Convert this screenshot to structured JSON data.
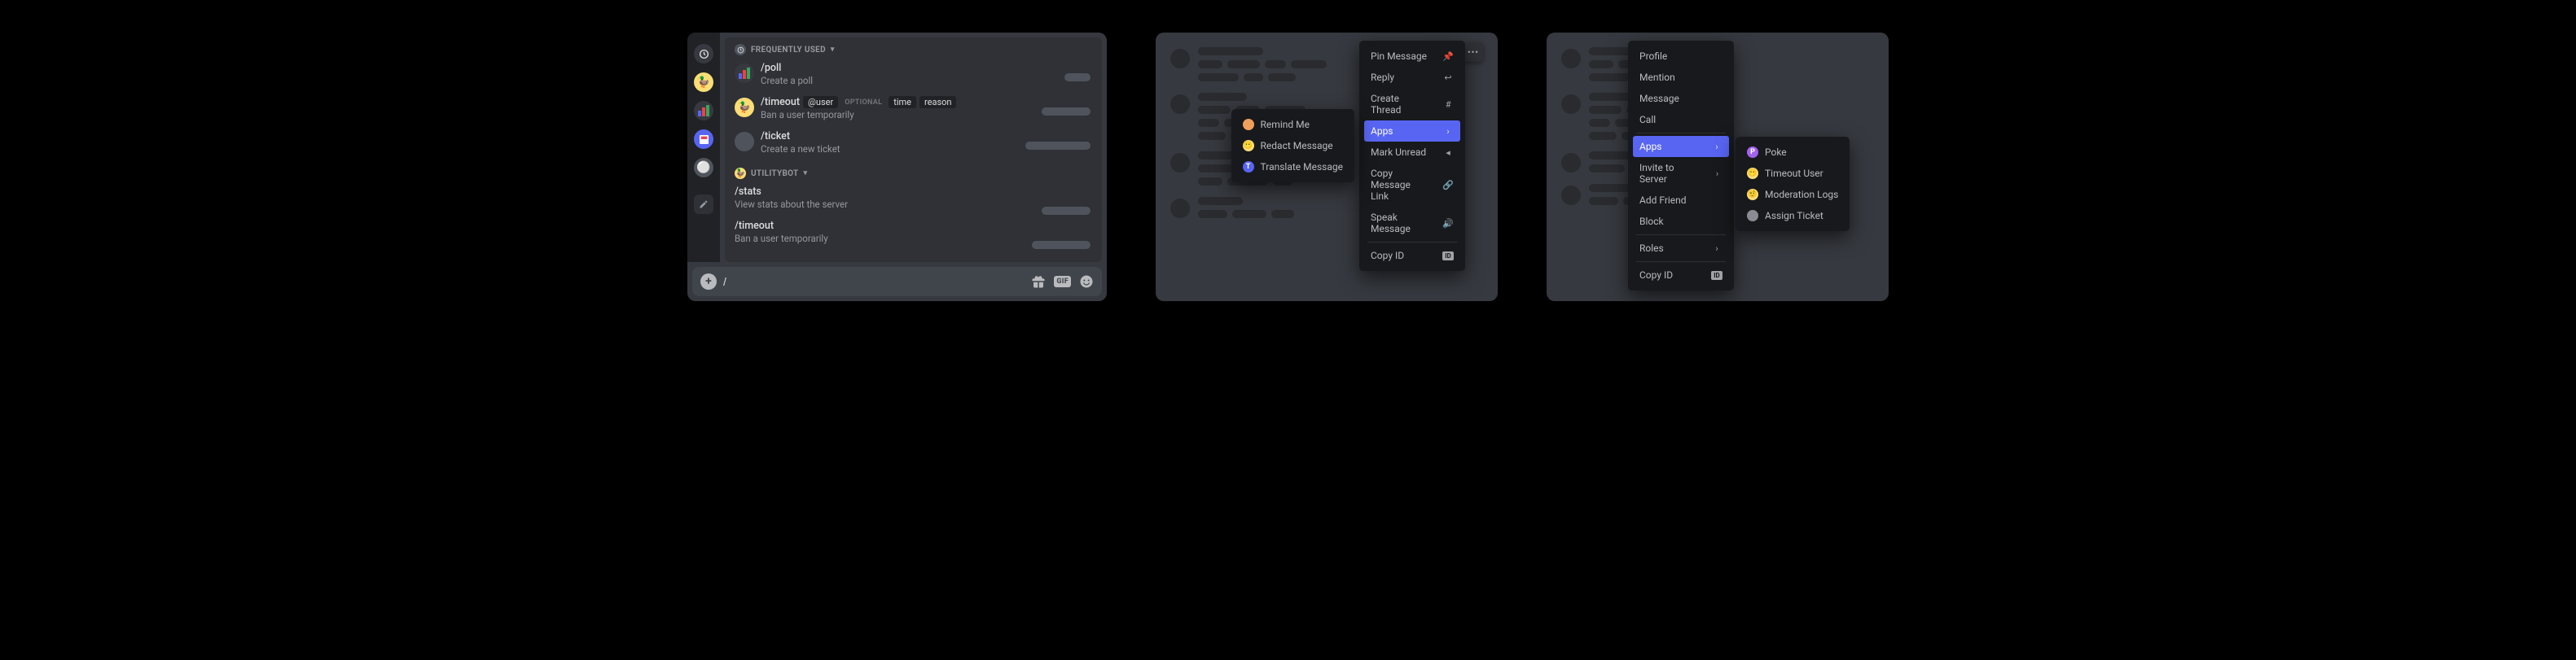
{
  "panel1": {
    "sections": {
      "freq_label": "FREQUENTLY USED",
      "bot_label": "UTILITYBOT"
    },
    "commands": {
      "poll": {
        "name": "/poll",
        "desc": "Create a poll"
      },
      "timeout": {
        "name": "/timeout",
        "arg1": "@user",
        "optional_label": "OPTIONAL",
        "arg2": "time",
        "arg3": "reason",
        "desc": "Ban a user temporarily"
      },
      "ticket": {
        "name": "/ticket",
        "desc": "Create a new ticket"
      },
      "stats": {
        "name": "/stats",
        "desc": "View stats about the server"
      },
      "timeout2": {
        "name": "/timeout",
        "desc": "Ban a user temporarily"
      }
    },
    "input_value": "/",
    "gif_label": "GIF"
  },
  "panel2": {
    "menu": {
      "pin": "Pin Message",
      "reply": "Reply",
      "thread": "Create Thread",
      "apps": "Apps",
      "unread": "Mark Unread",
      "copylink": "Copy Message Link",
      "speak": "Speak Message",
      "copyid": "Copy ID"
    },
    "apps_submenu": {
      "remind": "Remind Me",
      "redact": "Redact Message",
      "translate": "Translate Message"
    }
  },
  "panel3": {
    "menu": {
      "profile": "Profile",
      "mention": "Mention",
      "message": "Message",
      "call": "Call",
      "apps": "Apps",
      "invite": "Invite to Server",
      "addfriend": "Add Friend",
      "block": "Block",
      "roles": "Roles",
      "copyid": "Copy ID"
    },
    "apps_submenu": {
      "poke": "Poke",
      "timeout_user": "Timeout User",
      "modlogs": "Moderation Logs",
      "assign": "Assign Ticket"
    }
  }
}
